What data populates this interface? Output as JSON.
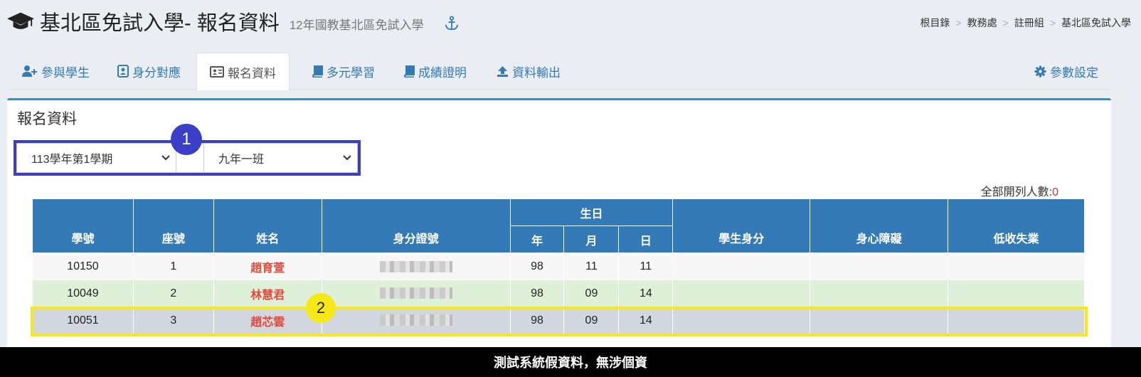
{
  "header": {
    "title": "基北區免試入學- 報名資料",
    "subtitle": "12年國教基北區免試入學"
  },
  "breadcrumb": [
    "根目錄",
    "教務處",
    "註冊組",
    "基北區免試入學"
  ],
  "tabs": [
    {
      "label": "參與學生",
      "icon": "user-plus-icon"
    },
    {
      "label": "身分對應",
      "icon": "id-badge-icon"
    },
    {
      "label": "報名資料",
      "icon": "id-card-icon"
    },
    {
      "label": "多元學習",
      "icon": "book-icon"
    },
    {
      "label": "成績證明",
      "icon": "book-icon"
    },
    {
      "label": "資料輸出",
      "icon": "upload-icon"
    }
  ],
  "settings_tab": {
    "label": "參數設定",
    "icon": "gear-icon"
  },
  "panel": {
    "title": "報名資料",
    "semester_select": "113學年第1學期",
    "class_select": "九年一班",
    "total_label": "全部開列人數:",
    "total_value": "0"
  },
  "annotations": {
    "badge1": "1",
    "badge2": "2"
  },
  "table": {
    "headers": {
      "student_id": "學號",
      "seat": "座號",
      "name": "姓名",
      "id_number": "身分證號",
      "birthday": "生日",
      "year": "年",
      "month": "月",
      "day": "日",
      "identity": "學生身分",
      "disability": "身心障礙",
      "low_income": "低收失業"
    },
    "rows": [
      {
        "student_id": "10150",
        "seat": "1",
        "name": "趙育萱",
        "year": "98",
        "month": "11",
        "day": "11",
        "identity": "",
        "disability": "",
        "low_income": ""
      },
      {
        "student_id": "10049",
        "seat": "2",
        "name": "林慧君",
        "year": "98",
        "month": "09",
        "day": "14",
        "identity": "",
        "disability": "",
        "low_income": ""
      },
      {
        "student_id": "10051",
        "seat": "3",
        "name": "趙芯雲",
        "year": "98",
        "month": "09",
        "day": "14",
        "identity": "",
        "disability": "",
        "low_income": ""
      }
    ]
  },
  "footer": "測試系統假資料，無涉個資"
}
